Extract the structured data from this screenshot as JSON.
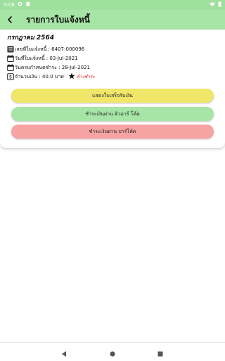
{
  "status_bar": {
    "time": "5:08"
  },
  "header": {
    "title": "รายการใบแจ้งหนี้"
  },
  "invoice": {
    "month": "กรกฎาคม 2564",
    "invoice_no_label": "เลขที่ใบแจ้งหนี้ : 6407-000096",
    "invoice_date_label": "วันที่ใบแจ้งหนี้ : 03-Jul-2021",
    "due_date_label": "วันครบกำหนดชำระ : 28-Jul-2021",
    "amount_label": "จำนวนเงิน : 40.0 บาท",
    "status": "ค้างชำระ"
  },
  "actions": {
    "show_receipt": "แสดงใบเสร็จรับเงิน",
    "pay_qr": "ชำระเงินผ่าน คิวอาร์ โค้ด",
    "pay_barcode": "ชำระเงินผ่าน บาร์โค้ด"
  },
  "colors": {
    "header_bg": "#a6e5a6",
    "status_bar_bg": "#9fe09f",
    "btn_yellow": "#f0e66a",
    "btn_green": "#a6e5a6",
    "btn_red": "#f6a3a3",
    "status_red": "#e02020"
  },
  "icons": {
    "back": "arrow-left-icon",
    "invoice_no": "document-list-icon",
    "invoice_date": "calendar-icon",
    "due_date": "calendar-icon",
    "amount": "money-icon",
    "status": "star-icon"
  }
}
